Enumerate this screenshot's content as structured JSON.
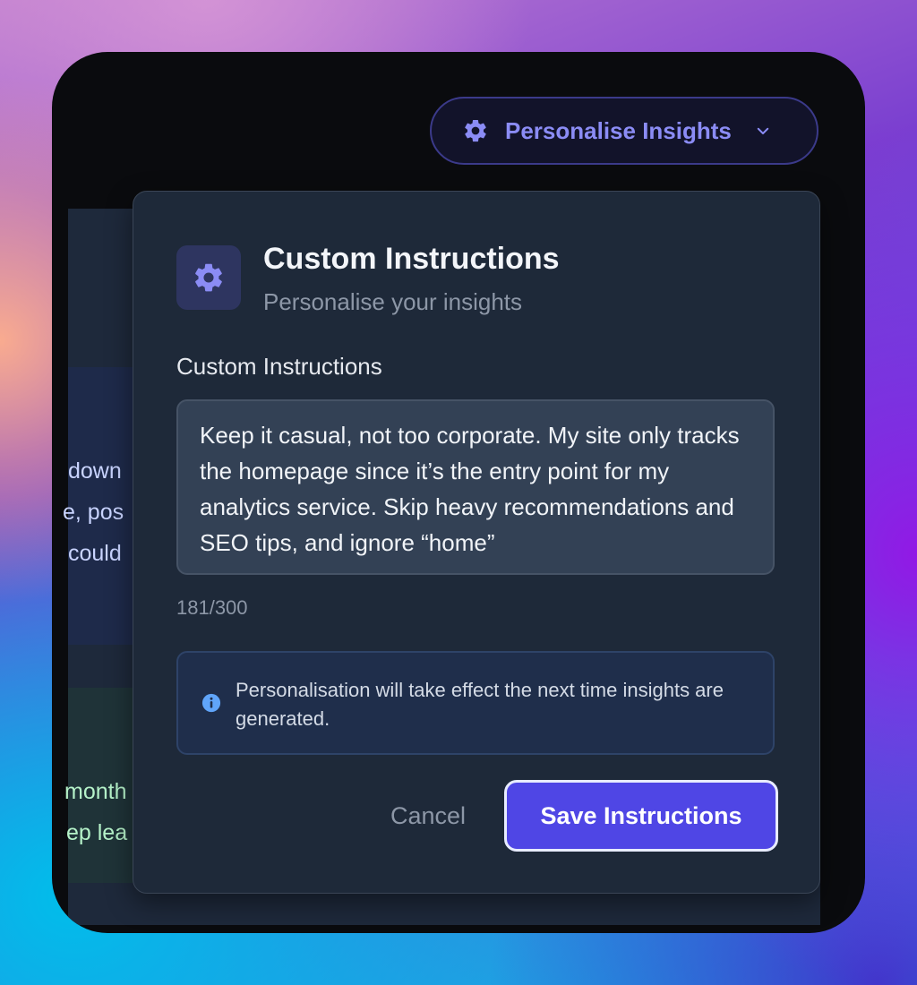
{
  "header": {
    "personalise_label": "Personalise Insights",
    "icon": "gear-icon",
    "dropdown_icon": "chevron-down-icon"
  },
  "background_fragments": {
    "blue_lines": [
      "down",
      "e, pos",
      " could"
    ],
    "green_lines": [
      "month",
      "ep lea"
    ]
  },
  "modal": {
    "title": "Custom Instructions",
    "subtitle": "Personalise your insights",
    "field_label": "Custom Instructions",
    "textarea_value": "Keep it casual, not too corporate. My site only tracks the homepage since it’s the entry point for my analytics service. Skip heavy recommendations and SEO tips, and ignore “home”",
    "char_count": "181/300",
    "info_text": "Personalisation will take effect the next time insights are generated.",
    "cancel_label": "Cancel",
    "save_label": "Save Instructions"
  },
  "colors": {
    "accent": "#4f46e5",
    "accent_text": "#8b8cf5",
    "modal_bg": "#1e2939",
    "info_bg": "#1f2e4b"
  }
}
